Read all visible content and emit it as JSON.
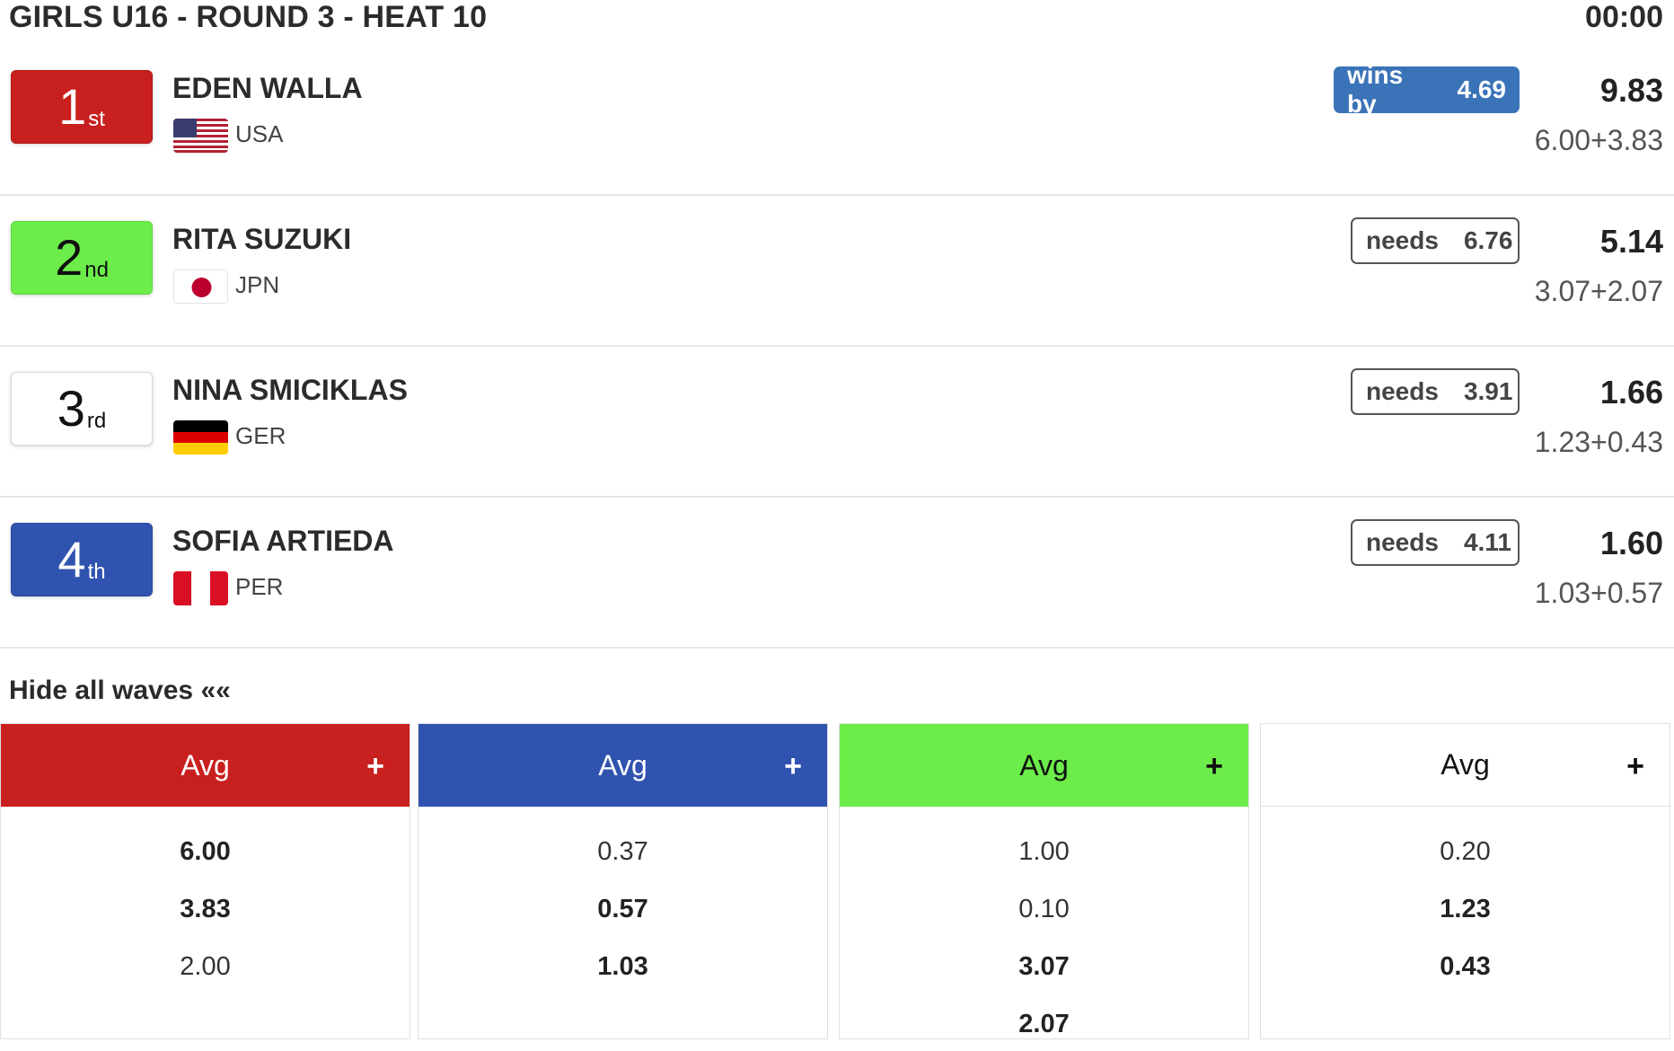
{
  "header": {
    "title": "GIRLS U16 - ROUND 3 - HEAT 10",
    "timer": "00:00"
  },
  "colors": {
    "red": "#c8201e",
    "green": "#6ced4a",
    "blue": "#3053b0",
    "white": "#ffffff",
    "badge_blue": "#3b73b8"
  },
  "athletes": [
    {
      "place": "1",
      "suffix": "st",
      "name": "EDEN WALLA",
      "country": "USA",
      "flag_icon": "usa-flag-icon",
      "badge_label": "wins by",
      "badge_value": "4.69",
      "total": "9.83",
      "breakdown": "6.00+3.83"
    },
    {
      "place": "2",
      "suffix": "nd",
      "name": "RITA SUZUKI",
      "country": "JPN",
      "flag_icon": "japan-flag-icon",
      "badge_label": "needs",
      "badge_value": "6.76",
      "total": "5.14",
      "breakdown": "3.07+2.07"
    },
    {
      "place": "3",
      "suffix": "rd",
      "name": "NINA SMICIKLAS",
      "country": "GER",
      "flag_icon": "germany-flag-icon",
      "badge_label": "needs",
      "badge_value": "3.91",
      "total": "1.66",
      "breakdown": "1.23+0.43"
    },
    {
      "place": "4",
      "suffix": "th",
      "name": "SOFIA ARTIEDA",
      "country": "PER",
      "flag_icon": "peru-flag-icon",
      "badge_label": "needs",
      "badge_value": "4.11",
      "total": "1.60",
      "breakdown": "1.03+0.57"
    }
  ],
  "waves_toggle": "Hide all waves ««",
  "wave_columns": [
    {
      "header": "Avg",
      "plus": "+",
      "scores": [
        "6.00",
        "3.83",
        "2.00"
      ],
      "counted": [
        true,
        true,
        false
      ]
    },
    {
      "header": "Avg",
      "plus": "+",
      "scores": [
        "0.37",
        "0.57",
        "1.03"
      ],
      "counted": [
        false,
        true,
        true
      ]
    },
    {
      "header": "Avg",
      "plus": "+",
      "scores": [
        "1.00",
        "0.10",
        "3.07",
        "2.07"
      ],
      "counted": [
        false,
        false,
        true,
        true
      ]
    },
    {
      "header": "Avg",
      "plus": "+",
      "scores": [
        "0.20",
        "1.23",
        "0.43"
      ],
      "counted": [
        false,
        true,
        true
      ]
    }
  ]
}
